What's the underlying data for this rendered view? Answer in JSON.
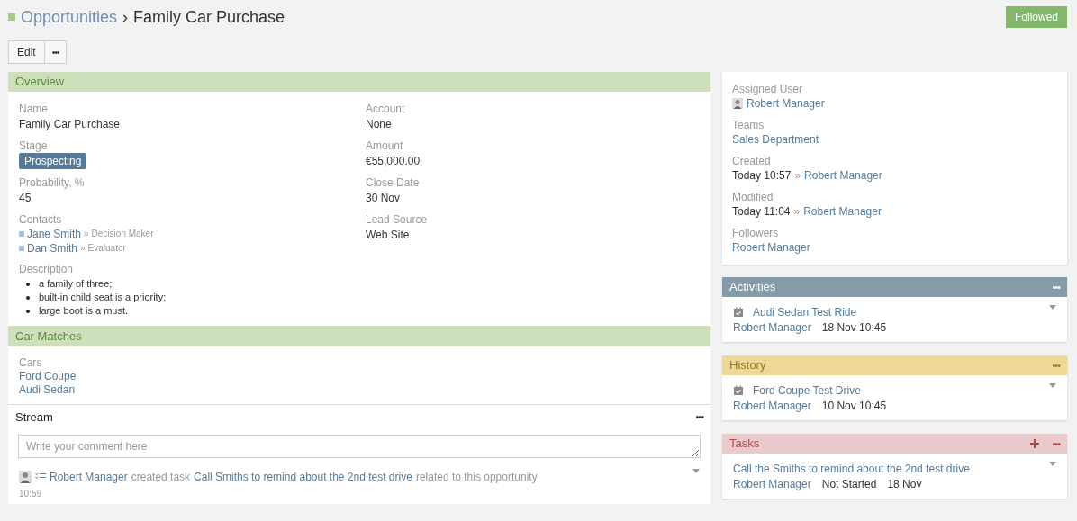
{
  "breadcrumb": {
    "module": "Opportunities",
    "separator": "›",
    "record": "Family Car Purchase"
  },
  "follow_button": {
    "label": "Followed",
    "followed": true
  },
  "actions": {
    "edit": "Edit",
    "more": "•••"
  },
  "overview": {
    "title": "Overview",
    "left_fields": [
      {
        "kind": "text",
        "label": "Name",
        "value": "Family Car Purchase"
      },
      {
        "kind": "badge",
        "label": "Stage",
        "value": "Prospecting"
      },
      {
        "kind": "text",
        "label": "Probability, %",
        "value": "45"
      },
      {
        "kind": "contacts",
        "label": "Contacts",
        "items": [
          {
            "name": "Jane Smith",
            "separator": "»",
            "role": "Decision Maker"
          },
          {
            "name": "Dan Smith",
            "separator": "»",
            "role": "Evaluator"
          }
        ]
      },
      {
        "kind": "list",
        "label": "Description",
        "items": [
          "a family of three;",
          "built-in child seat is a priority;",
          "large boot is a must."
        ]
      }
    ],
    "right_fields": [
      {
        "kind": "text",
        "label": "Account",
        "value": "None"
      },
      {
        "kind": "text",
        "label": "Amount",
        "value": "€55,000.00"
      },
      {
        "kind": "text",
        "label": "Close Date",
        "value": "30 Nov"
      },
      {
        "kind": "text",
        "label": "Lead Source",
        "value": "Web Site"
      }
    ]
  },
  "car_matches": {
    "title": "Car Matches",
    "label": "Cars",
    "items": [
      "Ford Coupe",
      "Audi Sedan"
    ]
  },
  "stream": {
    "title": "Stream",
    "more": "•••",
    "placeholder": "Write your comment here",
    "entries": [
      {
        "user": "Robert Manager",
        "action": "created task",
        "target": "Call Smiths to remind about the 2nd test drive",
        "suffix": "related to this opportunity",
        "time": "10:59"
      }
    ]
  },
  "side_fields": [
    {
      "kind": "user",
      "label": "Assigned User",
      "link": "Robert Manager"
    },
    {
      "kind": "link",
      "label": "Teams",
      "link": "Sales Department"
    },
    {
      "kind": "stamp",
      "label": "Created",
      "value": "Today 10:57",
      "separator": "»",
      "link": "Robert Manager"
    },
    {
      "kind": "stamp",
      "label": "Modified",
      "value": "Today 11:04",
      "separator": "»",
      "link": "Robert Manager"
    },
    {
      "kind": "link",
      "label": "Followers",
      "link": "Robert Manager"
    }
  ],
  "panels": [
    {
      "kind": "activities",
      "title": "Activities",
      "more": "•••",
      "can_create": false,
      "items": [
        {
          "kind": "meeting",
          "title": "Audi Sedan Test Ride",
          "user": "Robert Manager",
          "details": [
            "18 Nov 10:45"
          ]
        }
      ]
    },
    {
      "kind": "history",
      "title": "History",
      "more": "•••",
      "can_create": false,
      "items": [
        {
          "kind": "meeting",
          "title": "Ford Coupe Test Drive",
          "user": "Robert Manager",
          "details": [
            "10 Nov 10:45"
          ]
        }
      ]
    },
    {
      "kind": "tasks",
      "title": "Tasks",
      "more": "•••",
      "can_create": true,
      "items": [
        {
          "kind": "task",
          "title": "Call the Smiths to remind about the 2nd test drive",
          "user": "Robert Manager",
          "details": [
            "Not Started",
            "18 Nov"
          ]
        }
      ]
    }
  ]
}
